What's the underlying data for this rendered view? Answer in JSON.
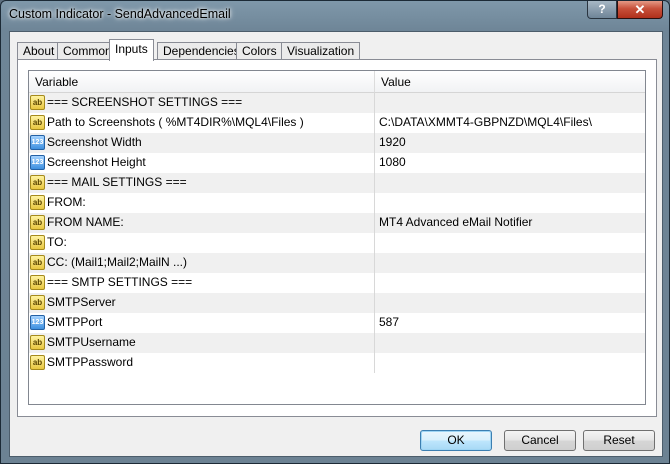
{
  "window": {
    "title": "Custom Indicator - SendAdvancedEmail",
    "help_label": "?",
    "close_label": "✕"
  },
  "tabs": [
    {
      "label": "About"
    },
    {
      "label": "Common"
    },
    {
      "label": "Inputs"
    },
    {
      "label": "Dependencies"
    },
    {
      "label": "Colors"
    },
    {
      "label": "Visualization"
    }
  ],
  "active_tab": "Inputs",
  "grid": {
    "columns": {
      "variable": "Variable",
      "value": "Value"
    },
    "rows": [
      {
        "type": "ab",
        "variable": "=== SCREENSHOT SETTINGS ===",
        "value": ""
      },
      {
        "type": "ab",
        "variable": "Path to Screenshots ( %MT4DIR%\\MQL4\\Files )",
        "value": "C:\\DATA\\XMMT4-GBPNZD\\MQL4\\Files\\"
      },
      {
        "type": "123",
        "variable": "Screenshot Width",
        "value": "1920"
      },
      {
        "type": "123",
        "variable": "Screenshot Height",
        "value": "1080"
      },
      {
        "type": "ab",
        "variable": "=== MAIL SETTINGS ===",
        "value": ""
      },
      {
        "type": "ab",
        "variable": "FROM:",
        "value": ""
      },
      {
        "type": "ab",
        "variable": "FROM NAME:",
        "value": "MT4 Advanced eMail Notifier"
      },
      {
        "type": "ab",
        "variable": "TO:",
        "value": ""
      },
      {
        "type": "ab",
        "variable": "CC: (Mail1;Mail2;MailN ...)",
        "value": ""
      },
      {
        "type": "ab",
        "variable": "=== SMTP SETTINGS ===",
        "value": ""
      },
      {
        "type": "ab",
        "variable": "SMTPServer",
        "value": ""
      },
      {
        "type": "123",
        "variable": "SMTPPort",
        "value": "587"
      },
      {
        "type": "ab",
        "variable": "SMTPUsername",
        "value": ""
      },
      {
        "type": "ab",
        "variable": "SMTPPassword",
        "value": ""
      }
    ]
  },
  "buttons": {
    "ok": "OK",
    "cancel": "Cancel",
    "reset": "Reset"
  }
}
